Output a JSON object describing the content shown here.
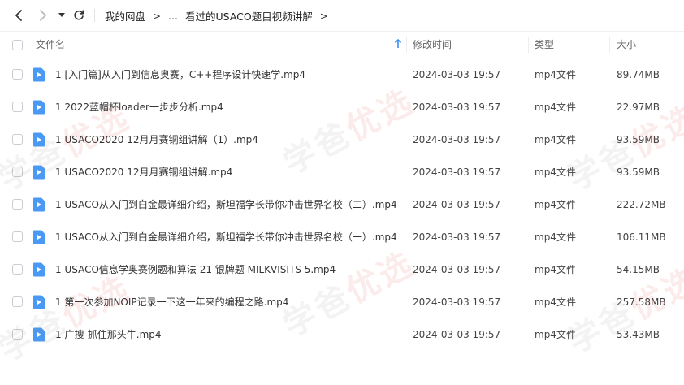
{
  "breadcrumb": {
    "root": "我的网盘",
    "ellipsis": "...",
    "current": "看过的USACO题目视频讲解",
    "chevron": ">"
  },
  "icons": {
    "back": "chevron-left-icon",
    "forward": "chevron-right-icon",
    "history": "dropdown-triangle-icon",
    "refresh": "refresh-icon",
    "file": "video-file-icon",
    "sort": "sort-arrow-up-icon"
  },
  "colors": {
    "accent": "#3a8ef6",
    "file_icon": "#4a9af5"
  },
  "columns": {
    "name": "文件名",
    "time": "修改时间",
    "type": "类型",
    "size": "大小"
  },
  "files": [
    {
      "name": "1 [入门篇]从入门到信息奥赛，C++程序设计快速学.mp4",
      "time": "2024-03-03 19:57",
      "type": "mp4文件",
      "size": "89.74MB"
    },
    {
      "name": "1 2022蓝帽杯loader一步步分析.mp4",
      "time": "2024-03-03 19:57",
      "type": "mp4文件",
      "size": "22.97MB"
    },
    {
      "name": "1 USACO2020  12月月赛铜组讲解（1）.mp4",
      "time": "2024-03-03 19:57",
      "type": "mp4文件",
      "size": "93.59MB"
    },
    {
      "name": "1 USACO2020  12月月赛铜组讲解.mp4",
      "time": "2024-03-03 19:57",
      "type": "mp4文件",
      "size": "93.59MB"
    },
    {
      "name": "1 USACO从入门到白金最详细介绍，斯坦福学长带你冲击世界名校（二）.mp4",
      "time": "2024-03-03 19:57",
      "type": "mp4文件",
      "size": "222.72MB"
    },
    {
      "name": "1 USACO从入门到白金最详细介绍，斯坦福学长带你冲击世界名校（一）.mp4",
      "time": "2024-03-03 19:57",
      "type": "mp4文件",
      "size": "106.11MB"
    },
    {
      "name": "1 USACO信息学奥赛例题和算法 21 银牌题 MILKVISITS 5.mp4",
      "time": "2024-03-03 19:57",
      "type": "mp4文件",
      "size": "54.15MB"
    },
    {
      "name": "1 第一次参加NOIP记录一下这一年来的编程之路.mp4",
      "time": "2024-03-03 19:57",
      "type": "mp4文件",
      "size": "257.58MB"
    },
    {
      "name": "1 广搜-抓住那头牛.mp4",
      "time": "2024-03-03 19:57",
      "type": "mp4文件",
      "size": "53.43MB"
    }
  ],
  "watermark": {
    "part1": "学爸",
    "part2": "优选"
  }
}
